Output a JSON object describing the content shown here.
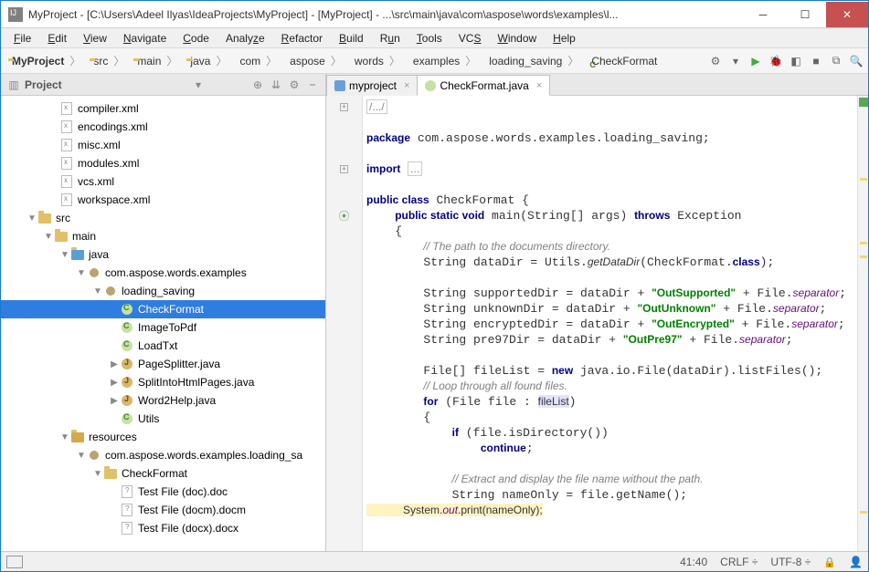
{
  "window": {
    "title": "MyProject - [C:\\Users\\Adeel Ilyas\\IdeaProjects\\MyProject] - [MyProject] - ...\\src\\main\\java\\com\\aspose\\words\\examples\\l..."
  },
  "menu": [
    "File",
    "Edit",
    "View",
    "Navigate",
    "Code",
    "Analyze",
    "Refactor",
    "Build",
    "Run",
    "Tools",
    "VCS",
    "Window",
    "Help"
  ],
  "breadcrumbs": [
    "MyProject",
    "src",
    "main",
    "java",
    "com",
    "aspose",
    "words",
    "examples",
    "loading_saving",
    "CheckFormat"
  ],
  "project_panel": {
    "title": "Project"
  },
  "tree": {
    "xml_files": [
      "compiler.xml",
      "encodings.xml",
      "misc.xml",
      "modules.xml",
      "vcs.xml",
      "workspace.xml"
    ],
    "src": "src",
    "main": "main",
    "java": "java",
    "pkg1": "com.aspose.words.examples",
    "pkg2": "loading_saving",
    "classes": [
      "CheckFormat",
      "ImageToPdf",
      "LoadTxt"
    ],
    "javafiles": [
      "PageSplitter.java",
      "SplitIntoHtmlPages.java",
      "Word2Help.java"
    ],
    "cls_utils": "Utils",
    "resources": "resources",
    "respkg": "com.aspose.words.examples.loading_sa",
    "resfolder": "CheckFormat",
    "testfiles": [
      "Test File (doc).doc",
      "Test File (docm).docm",
      "Test File (docx).docx"
    ]
  },
  "tabs": [
    {
      "label": "myproject",
      "active": false
    },
    {
      "label": "CheckFormat.java",
      "active": true
    }
  ],
  "code": {
    "l1": "/.../",
    "l3": "package com.aspose.words.examples.loading_saving;",
    "l5": "import ...",
    "l7a": "public class CheckFormat {",
    "l8": "    public static void main(String[] args) throws Exception",
    "l9": "    {",
    "l10": "        // The path to the documents directory.",
    "l11": "        String dataDir = Utils.getDataDir(CheckFormat.class);",
    "l13a": "        String supportedDir = dataDir + \"OutSupported\" + File.separator;",
    "l14a": "        String unknownDir = dataDir + \"OutUnknown\" + File.separator;",
    "l15a": "        String encryptedDir = dataDir + \"OutEncrypted\" + File.separator;",
    "l16a": "        String pre97Dir = dataDir + \"OutPre97\" + File.separator;",
    "l18": "        File[] fileList = new java.io.File(dataDir).listFiles();",
    "l19": "        // Loop through all found files.",
    "l20": "        for (File file : fileList)",
    "l21": "        {",
    "l22": "            if (file.isDirectory())",
    "l23": "                continue;",
    "l25": "            // Extract and display the file name without the path.",
    "l26": "            String nameOnly = file.getName();",
    "l27": "            System.out.print(nameOnly);"
  },
  "statusbar": {
    "pos": "41:40",
    "eol": "CRLF",
    "enc": "UTF-8"
  }
}
